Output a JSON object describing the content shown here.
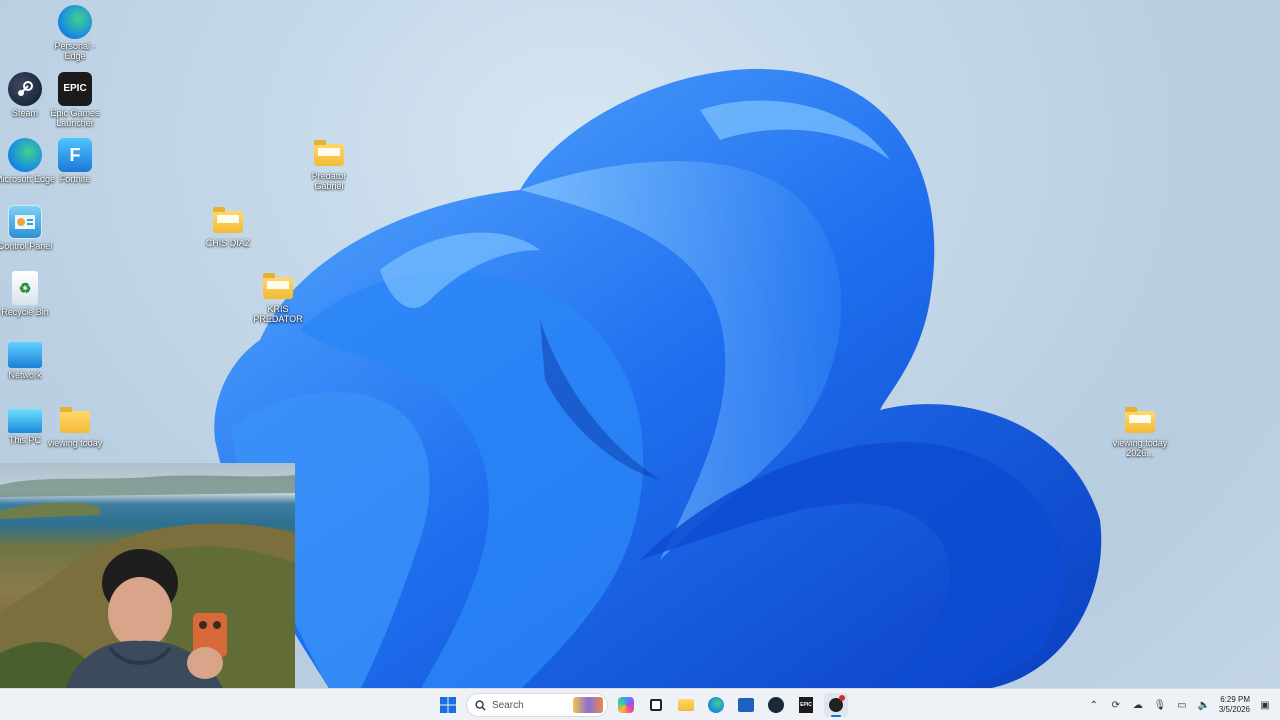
{
  "desktop": {
    "icons": {
      "personal_edge": "Personal - Edge",
      "steam": "Steam",
      "epic_games": "Epic Games Launcher",
      "microsoft_edge": "Microsoft Edge",
      "fortnite": "Fortnite",
      "control_panel": "Control Panel",
      "recycle_bin": "Recycle Bin",
      "network": "Network",
      "this_pc": "This PC",
      "viewing_today": "viewing today",
      "predator_gabriel": "Predator Gabriel",
      "chris_diaz": "CHIS DIAZ",
      "kris_predator": "KRIS PREDATOR",
      "viewing_today_2026": "viewing today 2026..."
    },
    "epic_glyph": "EPIC",
    "fortnite_glyph": "F"
  },
  "taskbar": {
    "search_placeholder": "Search",
    "clock_time": "6:29 PM",
    "clock_date": "3/5/2026"
  },
  "colors": {
    "accent": "#1a6fe0",
    "wallpaper_bloom": "#1b66e8",
    "taskbar": "#eef2f6"
  }
}
